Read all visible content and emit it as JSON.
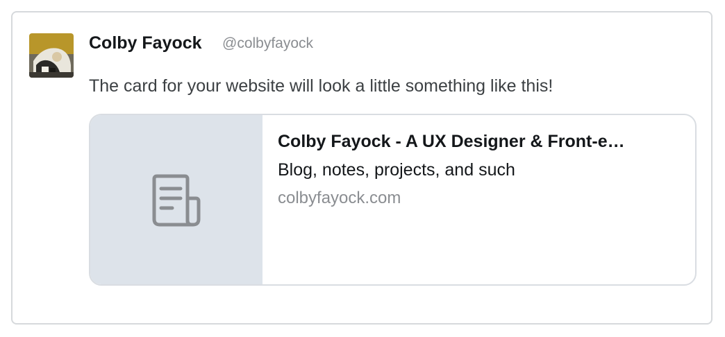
{
  "tweet": {
    "author_name": "Colby Fayock",
    "author_handle": "@colbyfayock",
    "text": "The card for your website will look a little something like this!"
  },
  "card": {
    "icon": "document-icon",
    "title": "Colby Fayock - A UX Designer & Front-e…",
    "description": "Blog, notes, projects, and such",
    "domain": "colbyfayock.com"
  },
  "colors": {
    "thumb_background": "#dde3ea",
    "icon": "#8a8d91",
    "border": "#d6d9dc"
  }
}
